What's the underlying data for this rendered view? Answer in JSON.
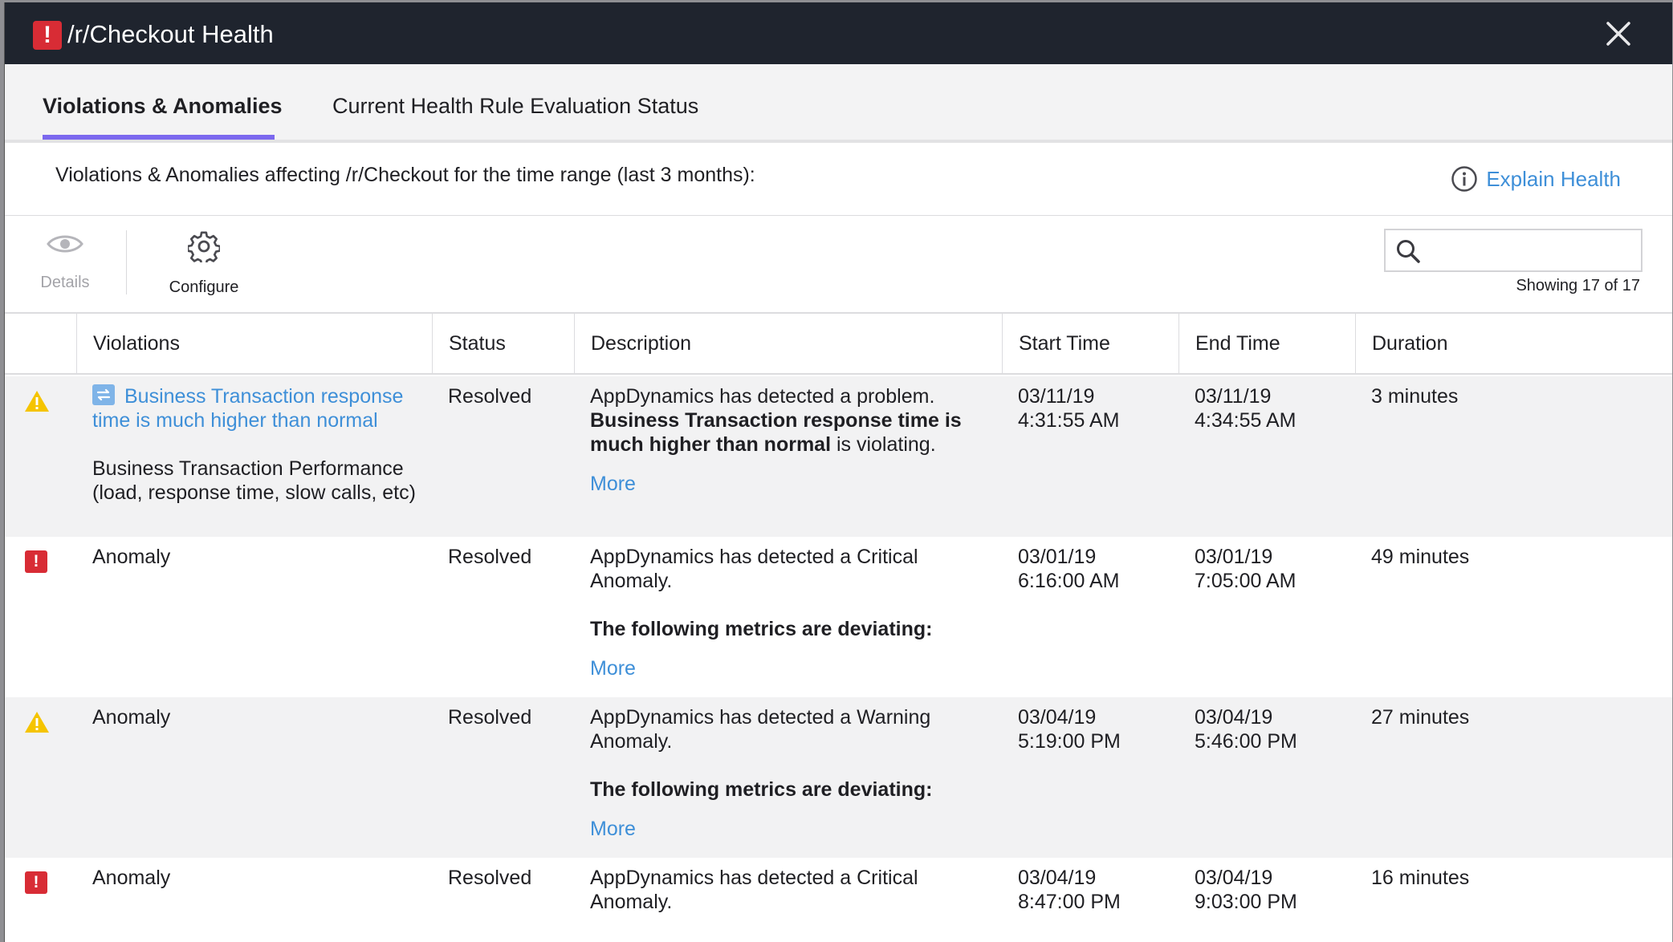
{
  "modal": {
    "title": "/r/Checkout Health",
    "title_badge": "!"
  },
  "tabs": [
    {
      "label": "Violations & Anomalies",
      "active": true
    },
    {
      "label": "Current Health Rule Evaluation Status",
      "active": false
    }
  ],
  "info": {
    "text": "Violations & Anomalies affecting /r/Checkout for the time range (last 3 months):",
    "explain_label": "Explain Health"
  },
  "toolbar": {
    "details_label": "Details",
    "configure_label": "Configure",
    "search_placeholder": "",
    "showing": "Showing 17 of 17"
  },
  "table": {
    "headers": [
      "Violations",
      "Status",
      "Description",
      "Start Time",
      "End Time",
      "Duration"
    ],
    "rows": [
      {
        "severity": "warning",
        "violation_link": "Business Transaction response time is much higher than normal",
        "violation_sub": "Business Transaction Performance (load, response time, slow calls, etc)",
        "status": "Resolved",
        "desc_line1": "AppDynamics has detected a problem.",
        "desc_bold": "Business Transaction response time is much higher than normal",
        "desc_tail": " is violating.",
        "more": "More",
        "start_date": "03/11/19",
        "start_time": "4:31:55 AM",
        "end_date": "03/11/19",
        "end_time": "4:34:55 AM",
        "duration": "3 minutes"
      },
      {
        "severity": "critical",
        "violation": "Anomaly",
        "status": "Resolved",
        "desc_line1": "AppDynamics has detected a Critical Anomaly.",
        "desc_bold": "The following metrics are deviating:",
        "more": "More",
        "start_date": "03/01/19",
        "start_time": "6:16:00 AM",
        "end_date": "03/01/19",
        "end_time": "7:05:00 AM",
        "duration": "49 minutes"
      },
      {
        "severity": "warning",
        "violation": "Anomaly",
        "status": "Resolved",
        "desc_line1": "AppDynamics has detected a Warning Anomaly.",
        "desc_bold": "The following metrics are deviating:",
        "more": "More",
        "start_date": "03/04/19",
        "start_time": "5:19:00 PM",
        "end_date": "03/04/19",
        "end_time": "5:46:00 PM",
        "duration": "27 minutes"
      },
      {
        "severity": "critical",
        "violation": "Anomaly",
        "status": "Resolved",
        "desc_line1": "AppDynamics has detected a Critical Anomaly.",
        "start_date": "03/04/19",
        "start_time": "8:47:00 PM",
        "end_date": "03/04/19",
        "end_time": "9:03:00 PM",
        "duration": "16 minutes"
      }
    ]
  },
  "colors": {
    "titlebar": "#1f242e",
    "critical": "#d82c35",
    "warning": "#f5c400",
    "link": "#3e8fd8",
    "tab_accent": "#7b68ee"
  },
  "icons": {
    "title": "alert-badge-icon",
    "close": "close-icon",
    "explain": "info-circle-icon",
    "details": "eye-icon",
    "configure": "gear-icon",
    "search": "search-icon",
    "warning": "warning-triangle-icon",
    "critical": "critical-badge-icon",
    "business_transaction": "business-transaction-icon"
  }
}
